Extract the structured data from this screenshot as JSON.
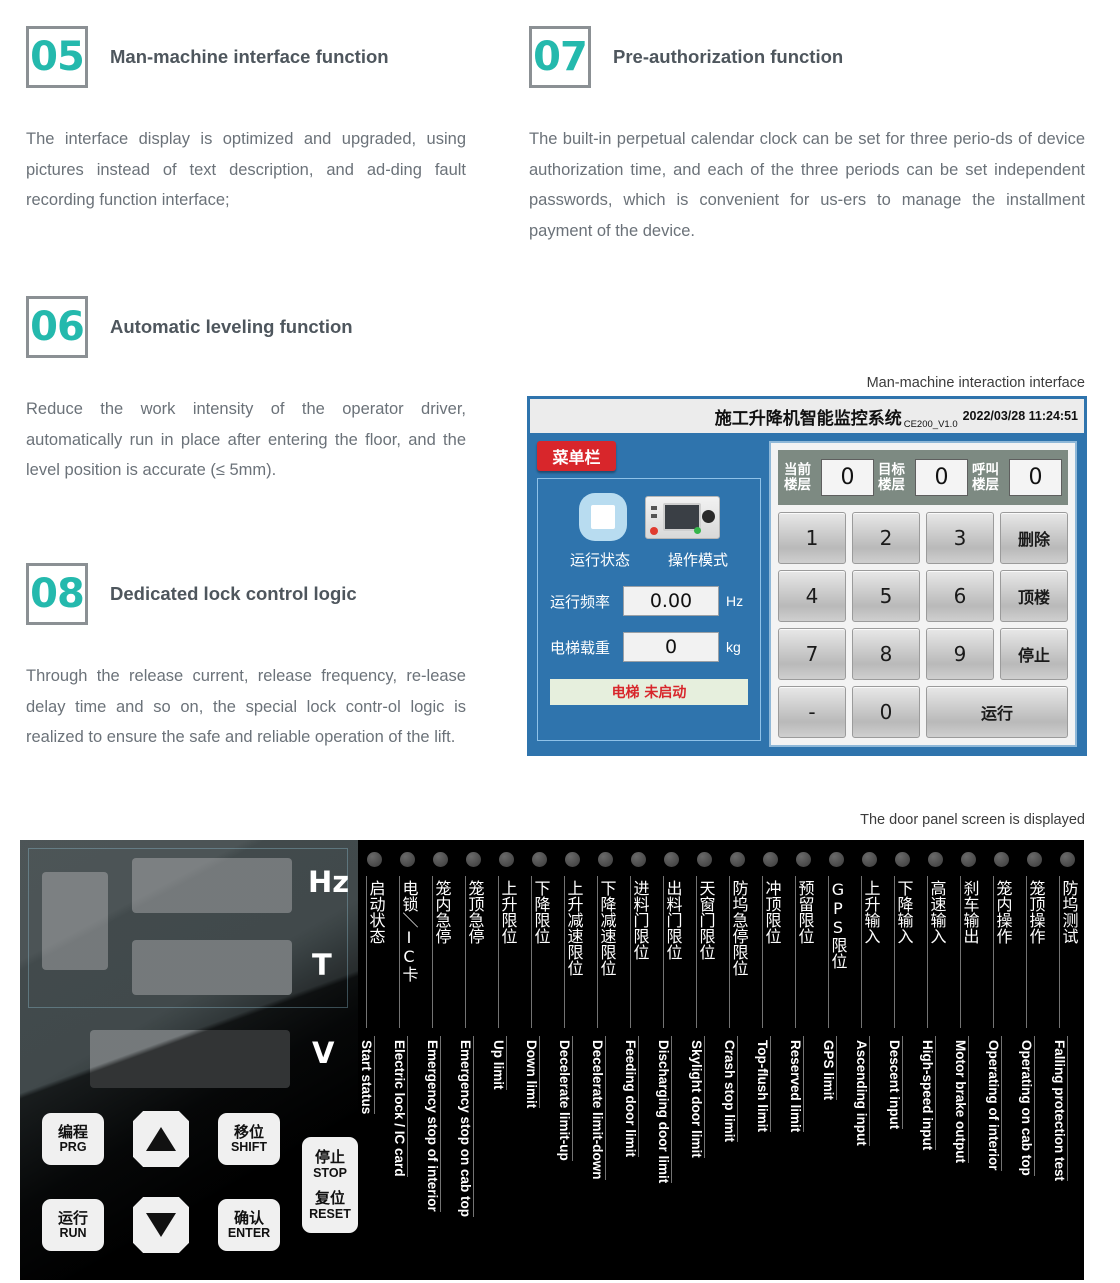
{
  "features": [
    {
      "number": "05",
      "title": "Man-machine interface function",
      "body": "The interface display is optimized and upgraded, using pictures instead of text description, and ad-ding fault recording function interface;"
    },
    {
      "number": "07",
      "title": "Pre-authorization function",
      "body": "The built-in perpetual calendar clock can be set for three perio-ds of device authorization time, and each of the three periods can be set independent passwords, which is convenient for us-ers to manage the installment payment of the device."
    },
    {
      "number": "06",
      "title": "Automatic leveling function",
      "body": "Reduce the work intensity of the operator driver, automatically run in place after entering the floor, and the level position is accurate (≤ 5mm)."
    },
    {
      "number": "08",
      "title": "Dedicated lock control logic",
      "body": "Through the release current, release frequency, re-lease delay time and so on, the special lock contr-ol logic is realized to ensure the safe and reliable operation of the lift."
    }
  ],
  "captions": {
    "hmi": "Man-machine interaction interface",
    "door_panel": "The door panel screen is displayed"
  },
  "hmi": {
    "title": "施工升降机智能监控系统",
    "version": "CE200_V1.0",
    "datetime": "2022/03/28 11:24:51",
    "menu_button": "菜单栏",
    "icon_labels": [
      "运行状态",
      "操作模式"
    ],
    "fields": [
      {
        "label": "运行频率",
        "value": "0.00",
        "unit": "Hz"
      },
      {
        "label": "电梯载重",
        "value": "0",
        "unit": "kg"
      }
    ],
    "alarm": "电梯 未启动",
    "floors": [
      {
        "label": "当前楼层",
        "value": "0"
      },
      {
        "label": "目标楼层",
        "value": "0"
      },
      {
        "label": "呼叫楼层",
        "value": "0"
      }
    ],
    "keys": [
      {
        "label": "1",
        "type": "num"
      },
      {
        "label": "2",
        "type": "num"
      },
      {
        "label": "3",
        "type": "num"
      },
      {
        "label": "删除",
        "type": "cn"
      },
      {
        "label": "4",
        "type": "num"
      },
      {
        "label": "5",
        "type": "num"
      },
      {
        "label": "6",
        "type": "num"
      },
      {
        "label": "顶楼",
        "type": "cn"
      },
      {
        "label": "7",
        "type": "num"
      },
      {
        "label": "8",
        "type": "num"
      },
      {
        "label": "9",
        "type": "num"
      },
      {
        "label": "停止",
        "type": "cn"
      },
      {
        "label": "-",
        "type": "num"
      },
      {
        "label": "0",
        "type": "num"
      },
      {
        "label": "运行",
        "type": "run"
      }
    ]
  },
  "door_panel": {
    "units": [
      "Hz",
      "T",
      "V"
    ],
    "buttons": [
      {
        "cn": "编程",
        "en": "PRG"
      },
      {
        "cn": "运行",
        "en": "RUN"
      },
      {
        "cn": "移位",
        "en": "SHIFT"
      },
      {
        "cn": "确认",
        "en": "ENTER"
      },
      {
        "cn": "停止",
        "en": "STOP"
      },
      {
        "cn": "复位",
        "en": "RESET"
      }
    ],
    "arrow_up": "up-arrow-icon",
    "arrow_down": "down-arrow-icon",
    "indicators": [
      {
        "cn": "启动状态",
        "en": "Start status"
      },
      {
        "cn": "电锁＼IC卡",
        "en": "Electric lock / IC card"
      },
      {
        "cn": "笼内急停",
        "en": "Emergency stop of interior"
      },
      {
        "cn": "笼顶急停",
        "en": "Emergency stop on cab top"
      },
      {
        "cn": "上升限位",
        "en": "Up limit"
      },
      {
        "cn": "下降限位",
        "en": "Down limit"
      },
      {
        "cn": "上升减速限位",
        "en": "Decelerate limit-up"
      },
      {
        "cn": "下降减速限位",
        "en": "Decelerate limit-down"
      },
      {
        "cn": "进料门限位",
        "en": "Feeding door limit"
      },
      {
        "cn": "出料门限位",
        "en": "Discharging door limit"
      },
      {
        "cn": "天窗门限位",
        "en": "Skylight door limit"
      },
      {
        "cn": "防坞急停限位",
        "en": "Crash  stop  limit"
      },
      {
        "cn": "冲顶限位",
        "en": "Top-flush limit"
      },
      {
        "cn": "预留限位",
        "en": "Reserved limit"
      },
      {
        "cn": "GPS限位",
        "en": "GPS limit"
      },
      {
        "cn": "上升输入",
        "en": "Ascending input"
      },
      {
        "cn": "下降输入",
        "en": "Descent input"
      },
      {
        "cn": "高速输入",
        "en": "High-speed input"
      },
      {
        "cn": "刹车输出",
        "en": "Motor brake output"
      },
      {
        "cn": "笼内操作",
        "en": "Operating of interior"
      },
      {
        "cn": "笼顶操作",
        "en": "Operating on cab top"
      },
      {
        "cn": "防坞测试",
        "en": "Falling protection test"
      }
    ]
  },
  "colors": {
    "accent_teal": "#24b9ad",
    "panel_blue": "#2f74ad",
    "menu_red": "#d8262b",
    "alarm_text": "#d8262b"
  }
}
